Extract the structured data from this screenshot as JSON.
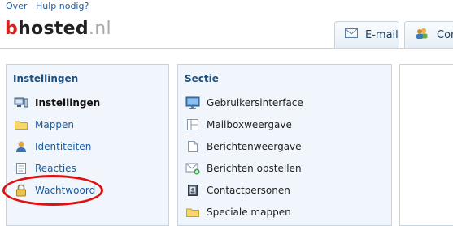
{
  "topLinks": [
    "Over",
    "Hulp nodig?"
  ],
  "logo": {
    "part1": "b",
    "part2": "hosted",
    "part3": ".nl"
  },
  "tabs": [
    {
      "label": "E-mail",
      "icon": "envelope-icon"
    },
    {
      "label": "Cont",
      "icon": "contacts-icon"
    }
  ],
  "leftPanel": {
    "title": "Instellingen",
    "items": [
      {
        "label": "Instellingen",
        "icon": "computer-icon",
        "selected": true
      },
      {
        "label": "Mappen",
        "icon": "folder-icon"
      },
      {
        "label": "Identiteiten",
        "icon": "user-icon"
      },
      {
        "label": "Reacties",
        "icon": "document-icon"
      },
      {
        "label": "Wachtwoord",
        "icon": "lock-icon",
        "highlighted": true
      }
    ]
  },
  "midPanel": {
    "title": "Sectie",
    "items": [
      {
        "label": "Gebruikersinterface",
        "icon": "monitor-icon"
      },
      {
        "label": "Mailboxweergave",
        "icon": "layout-icon"
      },
      {
        "label": "Berichtenweergave",
        "icon": "page-icon"
      },
      {
        "label": "Berichten opstellen",
        "icon": "compose-icon"
      },
      {
        "label": "Contactpersonen",
        "icon": "addressbook-icon"
      },
      {
        "label": "Speciale mappen",
        "icon": "folder-icon"
      }
    ]
  },
  "colors": {
    "link": "#1d5a9c",
    "panelBg": "#f0f6fb",
    "border": "#c7d3de",
    "highlight": "#e01010",
    "logoRed": "#d6231c"
  }
}
